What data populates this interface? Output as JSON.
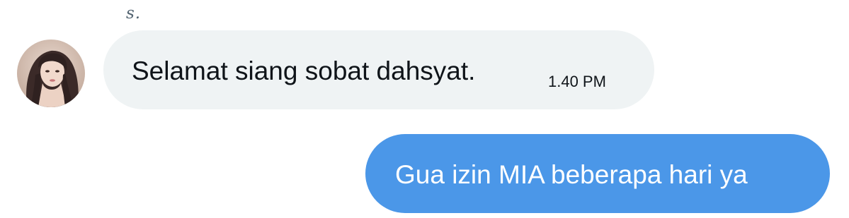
{
  "conversation": {
    "sender_name": "s.",
    "incoming": {
      "text": "Selamat siang sobat dahsyat.",
      "time": "1.40 PM"
    },
    "outgoing": {
      "text": "Gua izin MIA beberapa hari ya"
    }
  },
  "icons": {
    "avatar": "profile-photo"
  },
  "colors": {
    "incoming_bubble": "#eff3f4",
    "outgoing_bubble": "#4b97e8",
    "outgoing_text": "#ffffff",
    "primary_text": "#0f1419",
    "secondary_text": "#536471"
  }
}
